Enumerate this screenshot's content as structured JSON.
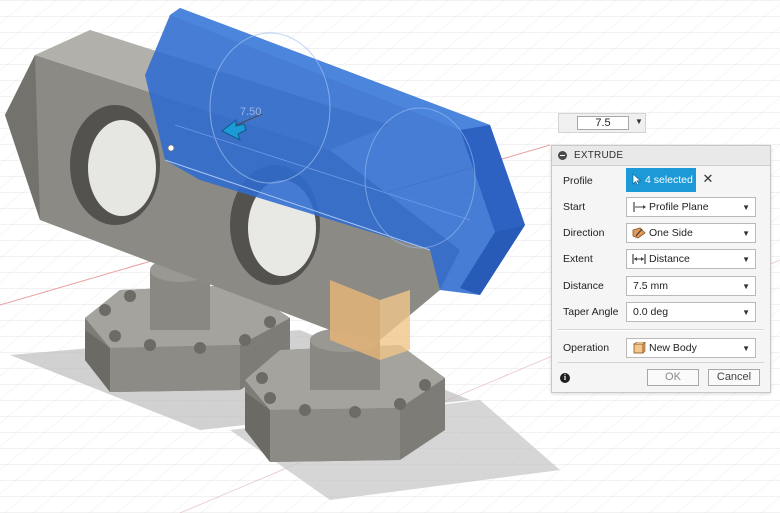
{
  "viewport": {
    "dimension_label": "7.50"
  },
  "float_input": {
    "value": "7.5"
  },
  "dialog": {
    "title": "EXTRUDE",
    "rows": [
      {
        "label": "Profile",
        "value": "4 selected"
      },
      {
        "label": "Start",
        "value": "Profile Plane"
      },
      {
        "label": "Direction",
        "value": "One Side"
      },
      {
        "label": "Extent",
        "value": "Distance"
      },
      {
        "label": "Distance",
        "value": "7.5 mm"
      },
      {
        "label": "Taper Angle",
        "value": "0.0 deg"
      },
      {
        "label": "Operation",
        "value": "New Body"
      }
    ],
    "ok_label": "OK",
    "cancel_label": "Cancel"
  },
  "colors": {
    "selection_blue": "#1b9ad7",
    "extrude_preview": "#2f68c8",
    "model_gray": "#8e8c86"
  }
}
